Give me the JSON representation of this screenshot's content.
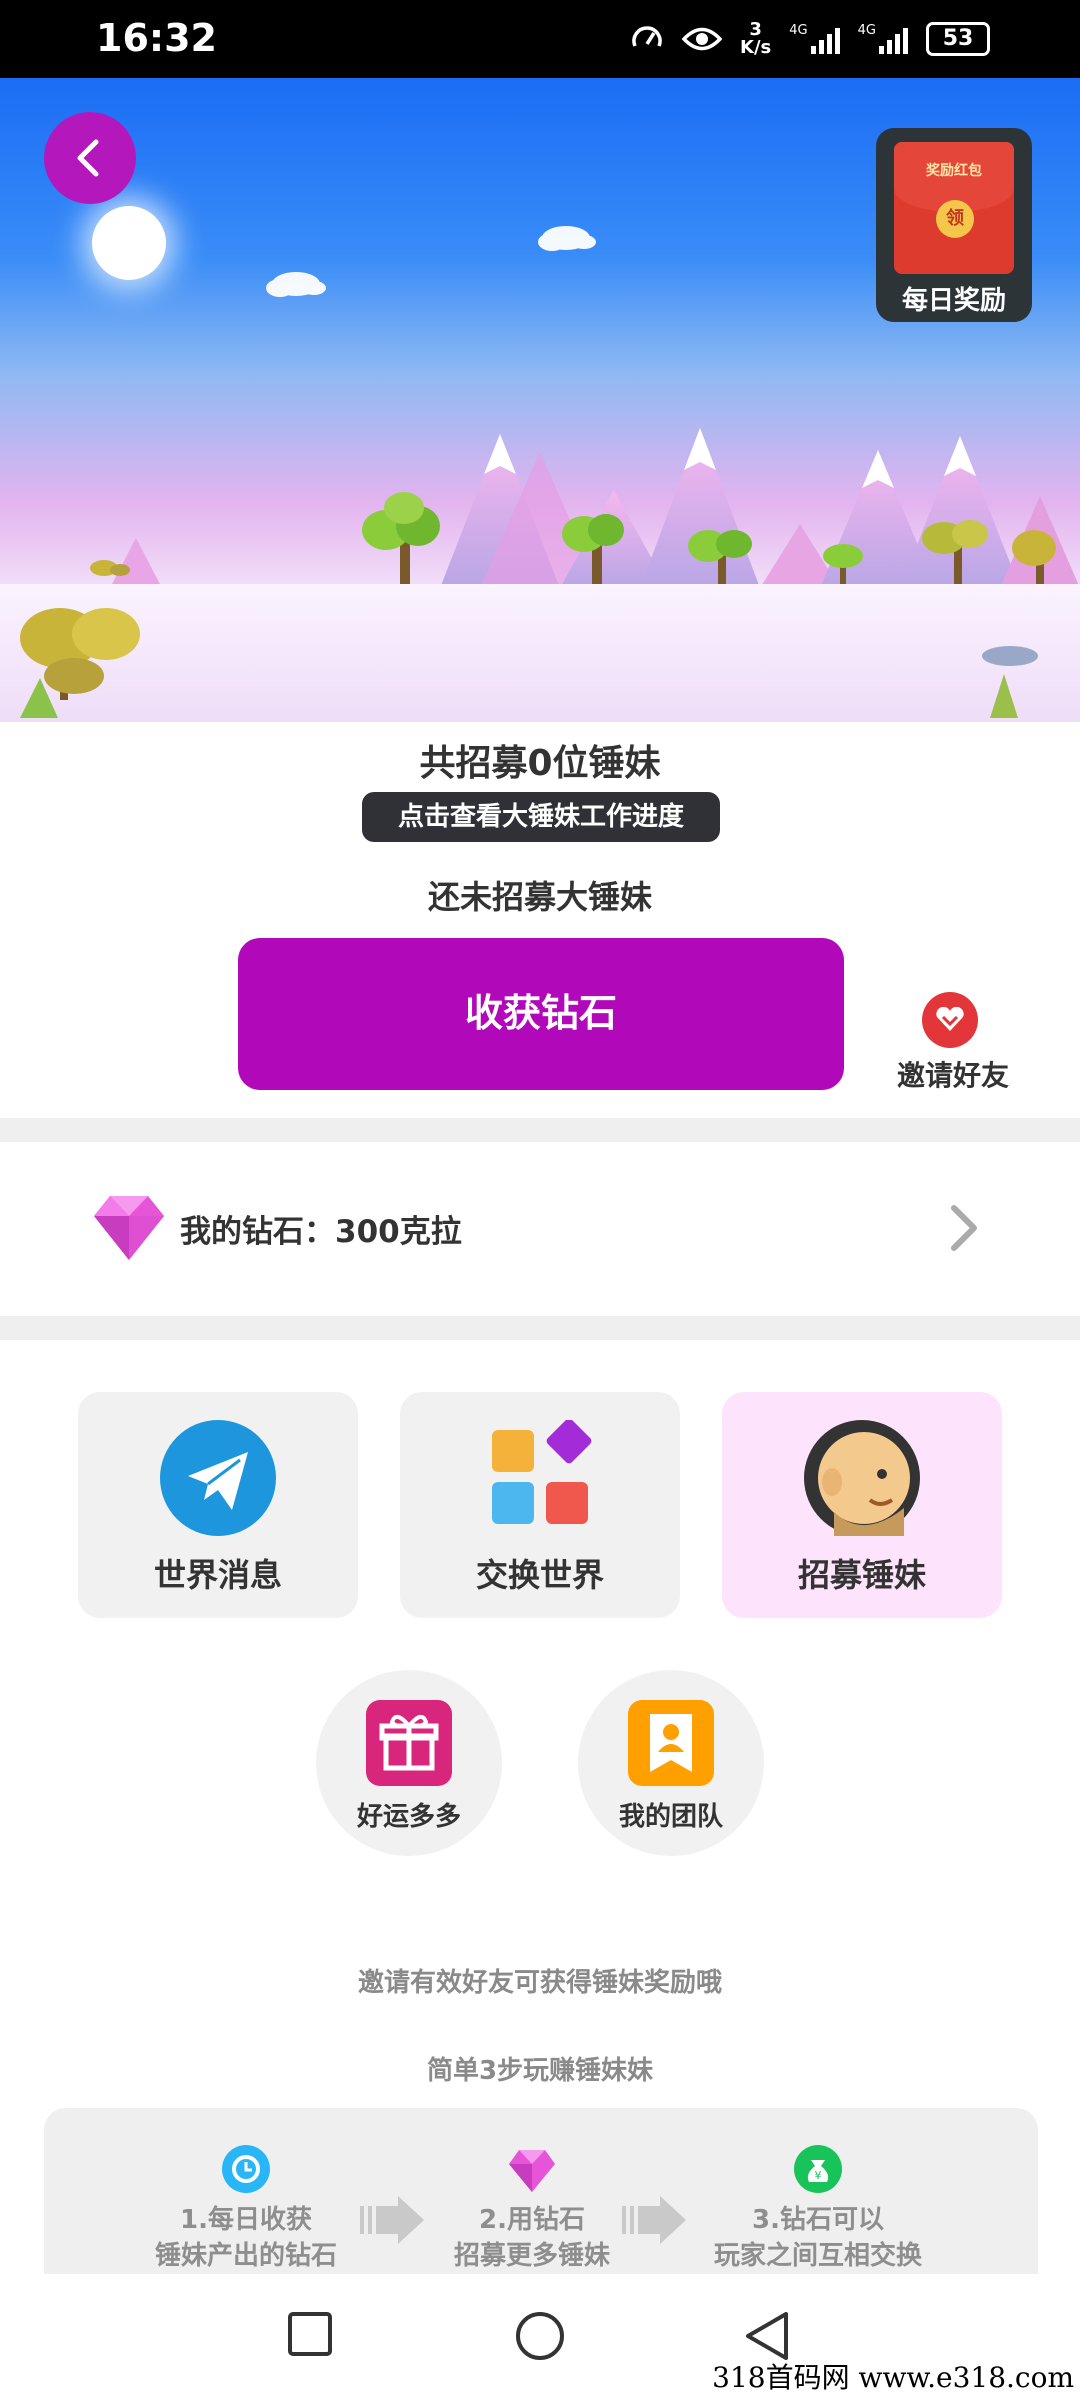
{
  "status": {
    "time": "16:32",
    "speed_top": "3",
    "speed_unit": "K/s",
    "net1": "4G",
    "net2": "4G",
    "battery": "53"
  },
  "hero": {
    "reward_envelope_title": "奖励红包",
    "reward_coin": "领",
    "reward_label": "每日奖励"
  },
  "recruit": {
    "title": "共招募0位锤妹",
    "progress_tip": "点击查看大锤妹工作进度",
    "status": "还未招募大锤妹",
    "harvest_button": "收获钻石",
    "invite_label": "邀请好友"
  },
  "diamonds": {
    "label": "我的钻石：300克拉"
  },
  "tiles": [
    {
      "label": "世界消息"
    },
    {
      "label": "交换世界"
    },
    {
      "label": "招募锤妹"
    }
  ],
  "round_tiles": [
    {
      "label": "好运多多"
    },
    {
      "label": "我的团队"
    }
  ],
  "notes": {
    "invite_note": "邀请有效好友可获得锤妹奖励哦",
    "steps_title": "简单3步玩赚锤妹妹"
  },
  "steps": [
    {
      "line1": "1.每日收获",
      "line2": "锤妹产出的钻石"
    },
    {
      "line1": "2.用钻石",
      "line2": "招募更多锤妹"
    },
    {
      "line1": "3.钻石可以",
      "line2": "玩家之间互相交换"
    }
  ],
  "watermark": "318首码网  www.e318.com",
  "colors": {
    "primary": "#b108ba",
    "invite": "#e2363a",
    "active_tile": "#fde3fb"
  }
}
